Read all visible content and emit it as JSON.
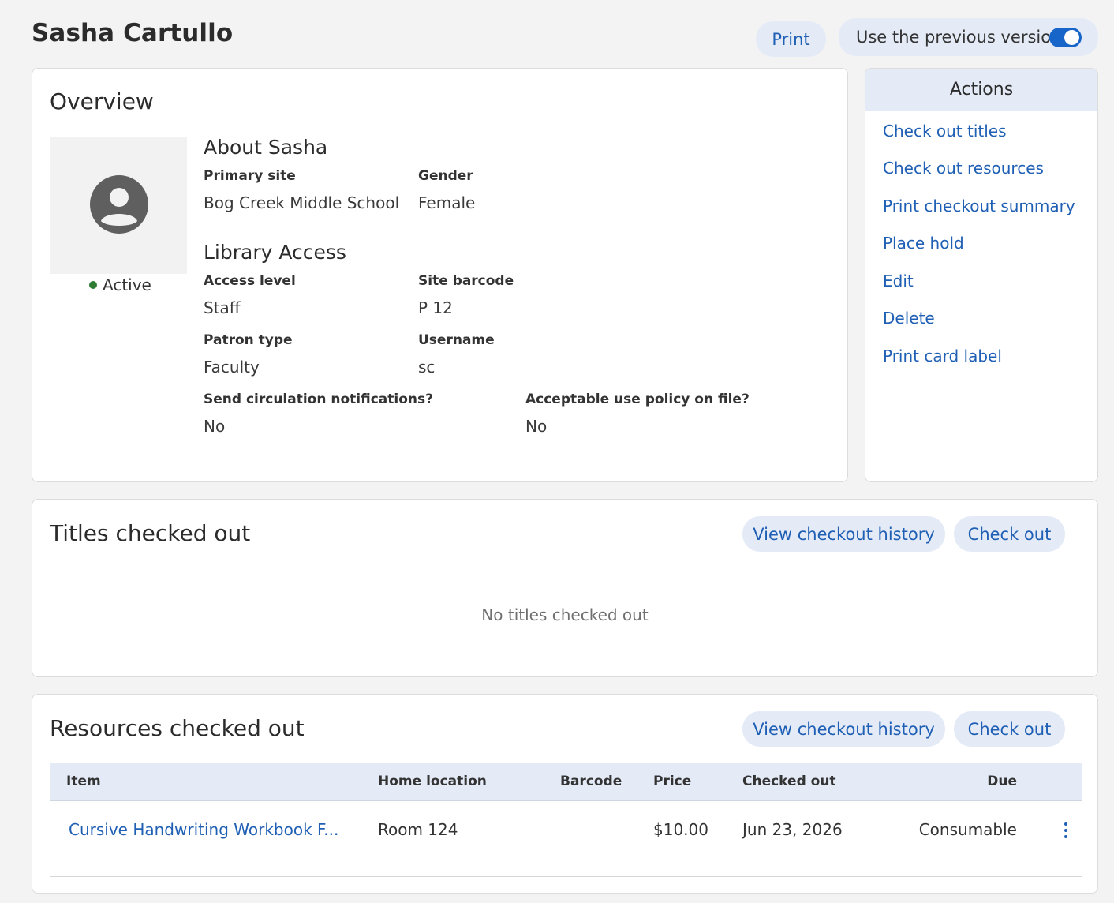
{
  "header": {
    "title": "Sasha Cartullo",
    "print_label": "Print",
    "toggle_label": "Use the previous version",
    "toggle_on": true
  },
  "overview": {
    "title": "Overview",
    "status": "Active",
    "about": {
      "title": "About Sasha",
      "primary_site_label": "Primary site",
      "primary_site": "Bog Creek Middle School",
      "gender_label": "Gender",
      "gender": "Female"
    },
    "library": {
      "title": "Library Access",
      "access_level_label": "Access level",
      "access_level": "Staff",
      "site_barcode_label": "Site barcode",
      "site_barcode": "P 12",
      "patron_type_label": "Patron type",
      "patron_type": "Faculty",
      "username_label": "Username",
      "username": "sc",
      "notifications_label": "Send circulation notifications?",
      "notifications": "No",
      "aup_label": "Acceptable use policy on file?",
      "aup": "No"
    }
  },
  "actions": {
    "title": "Actions",
    "items": [
      "Check out titles",
      "Check out resources",
      "Print checkout summary",
      "Place hold",
      "Edit",
      "Delete",
      "Print card label"
    ]
  },
  "titles_section": {
    "title": "Titles checked out",
    "history_label": "View checkout history",
    "checkout_label": "Check out",
    "empty_message": "No titles checked out"
  },
  "resources_section": {
    "title": "Resources checked out",
    "history_label": "View checkout history",
    "checkout_label": "Check out",
    "columns": [
      "Item",
      "Home location",
      "Barcode",
      "Price",
      "Checked out",
      "Due"
    ],
    "rows": [
      {
        "item": "Cursive Handwriting Workbook F...",
        "home_location": "Room 124",
        "barcode": "",
        "price": "$10.00",
        "checked_out": "Jun 23, 2026",
        "due": "Consumable"
      }
    ]
  },
  "colors": {
    "accent": "#1f5fb4",
    "pill_bg": "#e4ebf7",
    "active_dot": "#2e7d32",
    "toggle": "#1765c8"
  }
}
